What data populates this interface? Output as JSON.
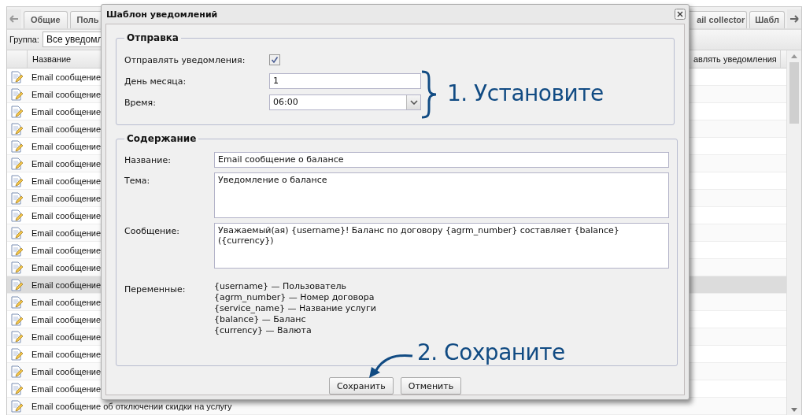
{
  "app": {
    "tabs": [
      {
        "label": "Общие"
      },
      {
        "label": "Поль"
      },
      {
        "label": "ail collector"
      },
      {
        "label": "Шабл"
      }
    ],
    "group_filter": {
      "label": "Группа:",
      "value": "Все уведомл"
    },
    "table": {
      "columns": [
        "Название",
        "авлять уведомления"
      ],
      "rows": [
        {
          "name": "Email сообщение",
          "selected": false
        },
        {
          "name": "Email сообщение",
          "selected": false
        },
        {
          "name": "Email сообщение",
          "selected": false
        },
        {
          "name": "Email сообщение",
          "selected": false
        },
        {
          "name": "Email сообщение",
          "selected": false
        },
        {
          "name": "Email сообщение",
          "selected": false
        },
        {
          "name": "Email сообщение",
          "selected": false
        },
        {
          "name": "Email сообщение",
          "selected": false
        },
        {
          "name": "Email сообщение",
          "selected": false
        },
        {
          "name": "Email сообщение",
          "selected": false
        },
        {
          "name": "Email сообщение",
          "selected": false
        },
        {
          "name": "Email сообщение",
          "selected": false
        },
        {
          "name": "Email сообщение",
          "selected": true
        },
        {
          "name": "Email сообщение",
          "selected": false
        },
        {
          "name": "Email сообщение",
          "selected": false
        },
        {
          "name": "Email сообщение",
          "selected": false
        },
        {
          "name": "Email сообщение",
          "selected": false
        },
        {
          "name": "Email сообщение",
          "selected": false
        },
        {
          "name": "Email сообщение",
          "selected": false
        },
        {
          "name": "Email сообщение об отключении скидки на услугу",
          "selected": false
        }
      ]
    }
  },
  "dialog": {
    "title": "Шаблон уведомлений",
    "sending": {
      "legend": "Отправка",
      "send_notifications": {
        "label": "Отправлять уведомления:",
        "checked": true
      },
      "day_of_month": {
        "label": "День месяца:",
        "value": "1"
      },
      "time": {
        "label": "Время:",
        "value": "06:00"
      }
    },
    "content": {
      "legend": "Содержание",
      "name": {
        "label": "Название:",
        "value": "Email сообщение о балансе"
      },
      "subject": {
        "label": "Тема:",
        "value": "Уведомление о балансе"
      },
      "message": {
        "label": "Сообщение:",
        "value": "Уважаемый(ая) {username}! Баланс по договору {agrm_number} составляет {balance} ({currency})"
      },
      "variables": {
        "label": "Переменные:",
        "lines": [
          "{username} — Пользователь",
          "{agrm_number} — Номер договора",
          "{service_name} — Название услуги",
          "{balance} — Баланс",
          "{currency} — Валюта"
        ]
      }
    },
    "buttons": [
      "Сохранить",
      "Отменить"
    ]
  },
  "annotations": [
    {
      "kind": "brace",
      "text": "1. Установите"
    },
    {
      "kind": "arrow",
      "text": "2. Сохраните"
    }
  ]
}
